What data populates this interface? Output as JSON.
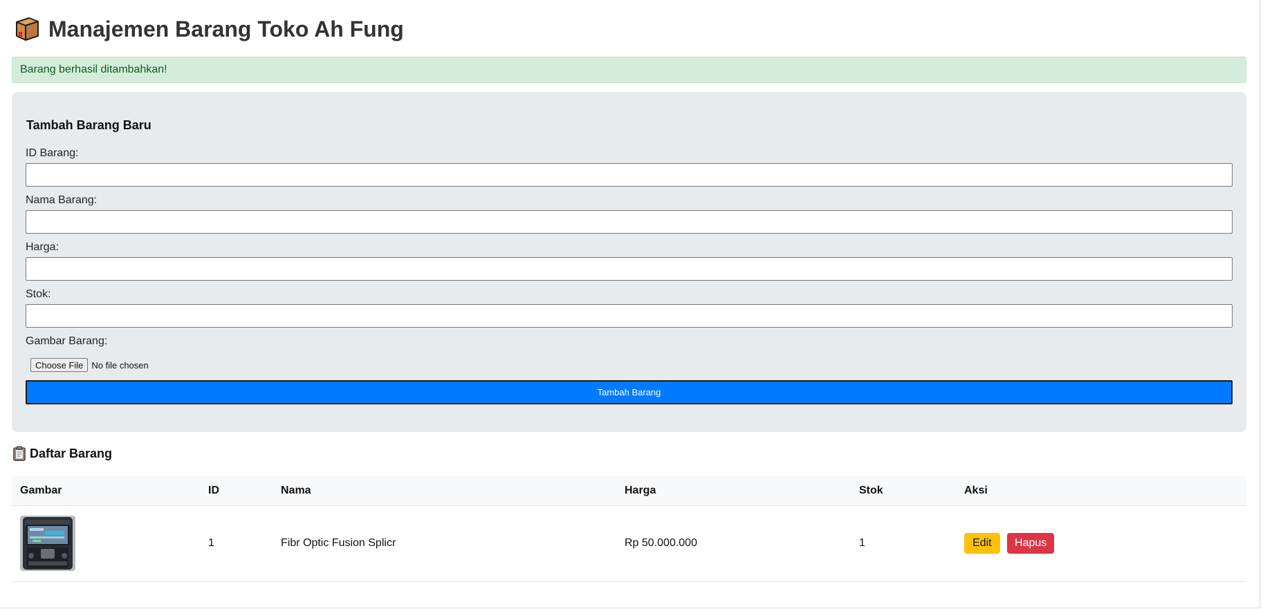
{
  "header": {
    "title": "Manajemen Barang Toko Ah Fung",
    "icon": "package-box-icon"
  },
  "alert": {
    "message": "Barang berhasil ditambahkan!",
    "type": "success",
    "color": "#155724"
  },
  "form": {
    "title": "Tambah Barang Baru",
    "fields": [
      {
        "label": "ID Barang:",
        "value": ""
      },
      {
        "label": "Nama Barang:",
        "value": ""
      },
      {
        "label": "Harga:",
        "value": ""
      },
      {
        "label": "Stok:",
        "value": ""
      }
    ],
    "image_field": {
      "label": "Gambar Barang:",
      "button_label": "Choose File",
      "status": "No file chosen"
    },
    "submit_label": "Tambah Barang",
    "submit_color": "#007bff"
  },
  "list": {
    "title": "Daftar Barang",
    "icon": "clipboard-icon",
    "columns": [
      "Gambar",
      "ID",
      "Nama",
      "Harga",
      "Stok",
      "Aksi"
    ],
    "rows": [
      {
        "image": "fusion-splicer-photo",
        "id": "1",
        "name": "Fibr Optic Fusion Splicr",
        "price": "Rp 50.000.000",
        "stock": "1",
        "edit_label": "Edit",
        "delete_label": "Hapus"
      }
    ],
    "edit_color": "#ffc107",
    "delete_color": "#dc3545"
  }
}
